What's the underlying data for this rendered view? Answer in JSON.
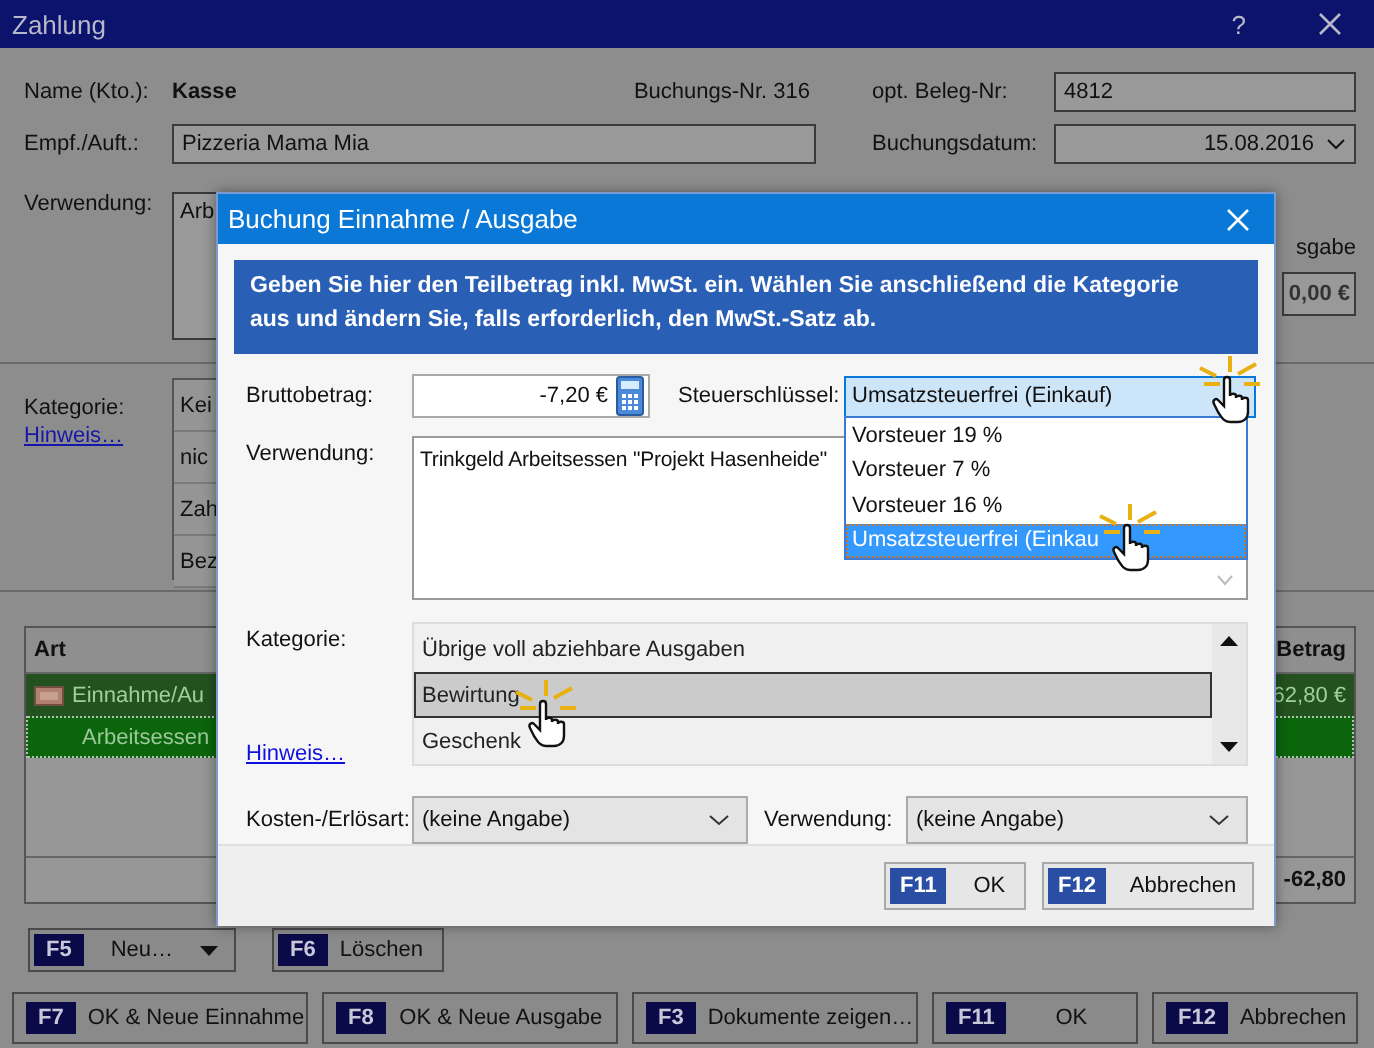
{
  "window": {
    "title": "Zahlung",
    "help": "?"
  },
  "header": {
    "name_label": "Name (Kto.):",
    "name": "Kasse",
    "booking_no": "Buchungs-Nr. 316",
    "receipt_label": "opt. Beleg-Nr:",
    "receipt": "4812",
    "payee_label": "Empf./Auft.:",
    "payee": "Pizzeria Mama Mia",
    "date_label": "Buchungsdatum:",
    "date": "15.08.2016",
    "purpose_label": "Verwendung:",
    "purpose": "Arb",
    "side_label": "sgabe",
    "side_amount": "0,00 €"
  },
  "category": {
    "label": "Kategorie:",
    "hint": "Hinweis…",
    "items": [
      {
        "label": "Kei"
      },
      {
        "label": "nic"
      },
      {
        "label": "Zah"
      },
      {
        "label": "Bez"
      }
    ]
  },
  "table": {
    "columns": [
      "Art",
      "Betrag"
    ],
    "rows": [
      {
        "kind": "group",
        "label": "Einnahme/Au",
        "amount": "62,80 €"
      },
      {
        "kind": "split",
        "label": "Arbeitsessen",
        "amount": ""
      }
    ],
    "total": "-62,80"
  },
  "actions": [
    {
      "key": "F5",
      "label": "Neu…",
      "dropdown": true
    },
    {
      "key": "F6",
      "label": "Löschen",
      "dropdown": false
    }
  ],
  "footer": [
    {
      "key": "F7",
      "label": "OK & Neue Einnahme"
    },
    {
      "key": "F8",
      "label": "OK & Neue Ausgabe"
    },
    {
      "key": "F3",
      "label": "Dokumente zeigen…"
    },
    {
      "key": "F11",
      "label": "OK"
    },
    {
      "key": "F12",
      "label": "Abbrechen"
    }
  ],
  "dialog": {
    "title": "Buchung Einnahme / Ausgabe",
    "info": "Geben Sie hier den Teilbetrag inkl. MwSt. ein. Wählen Sie anschließend die Kategorie aus und ändern Sie, falls erforderlich, den MwSt.-Satz ab.",
    "gross_label": "Bruttobetrag:",
    "gross": "-7,20 €",
    "tax_label": "Steuerschlüssel:",
    "tax": "Umsatzsteuerfrei (Einkauf)",
    "tax_options": [
      {
        "label": "Vorsteuer 19 %",
        "selected": false
      },
      {
        "label": "Vorsteuer 7 %",
        "selected": false
      },
      {
        "label": "Vorsteuer 16 %",
        "selected": false
      },
      {
        "label": "Umsatzsteuerfrei (Einkau",
        "selected": true
      }
    ],
    "purpose_label": "Verwendung:",
    "purpose": "Trinkgeld Arbeitsessen \"Projekt Hasenheide\"",
    "category_label": "Kategorie:",
    "hint": "Hinweis…",
    "categories": [
      {
        "label": "Übrige voll abziehbare Ausgaben",
        "selected": false
      },
      {
        "label": "Bewirtung",
        "selected": true
      },
      {
        "label": "Geschenk",
        "selected": false
      }
    ],
    "cost_label": "Kosten-/Erlösart:",
    "cost": "(keine Angabe)",
    "usage_label": "Verwendung:",
    "usage": "(keine Angabe)",
    "buttons": [
      {
        "key": "F11",
        "label": "OK"
      },
      {
        "key": "F12",
        "label": "Abbrechen"
      }
    ]
  }
}
